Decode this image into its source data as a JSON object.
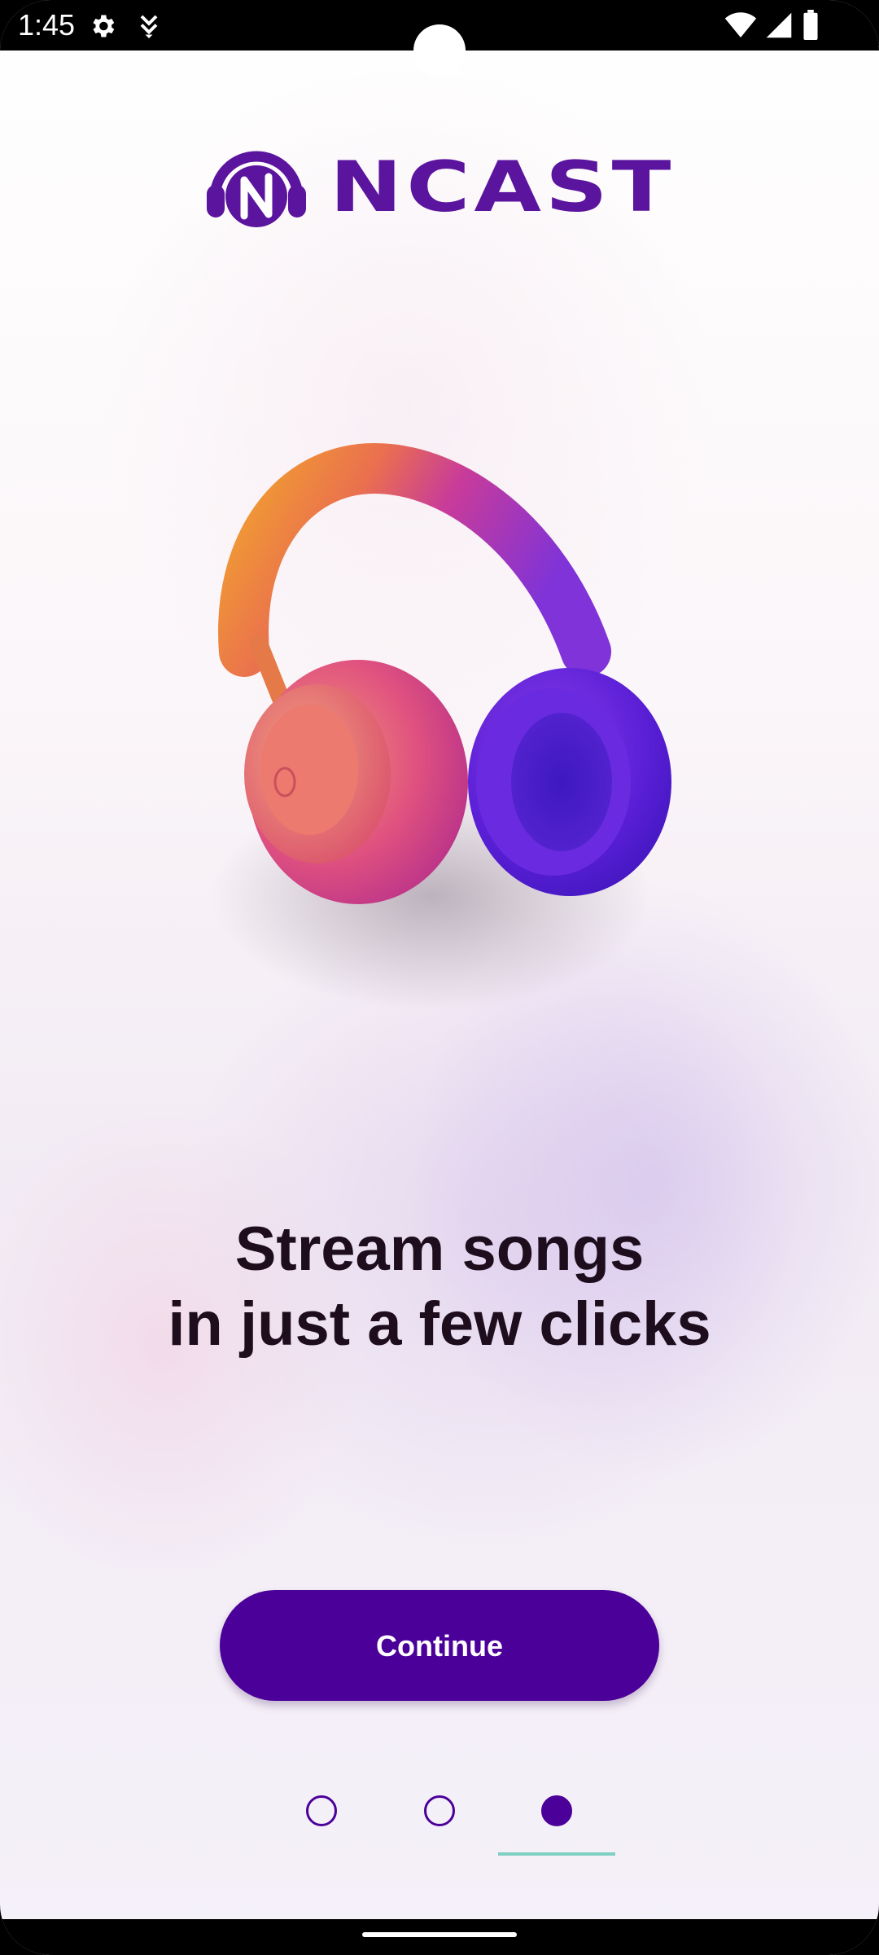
{
  "status_bar": {
    "time": "1:45",
    "icons": [
      "gear-icon",
      "download-status-icon",
      "wifi-icon",
      "cell-signal-icon",
      "battery-icon"
    ]
  },
  "logo": {
    "text": "NCAST",
    "brand_color": "#5a149e"
  },
  "illustration": {
    "icon": "headphones-illustration"
  },
  "headline": {
    "line1": "Stream songs",
    "line2": "in just a few clicks"
  },
  "continue_button": {
    "label": "Continue",
    "color": "#4b0099"
  },
  "pager": {
    "pages": 3,
    "current": 3,
    "indicator_color": "#7fcfc3"
  }
}
